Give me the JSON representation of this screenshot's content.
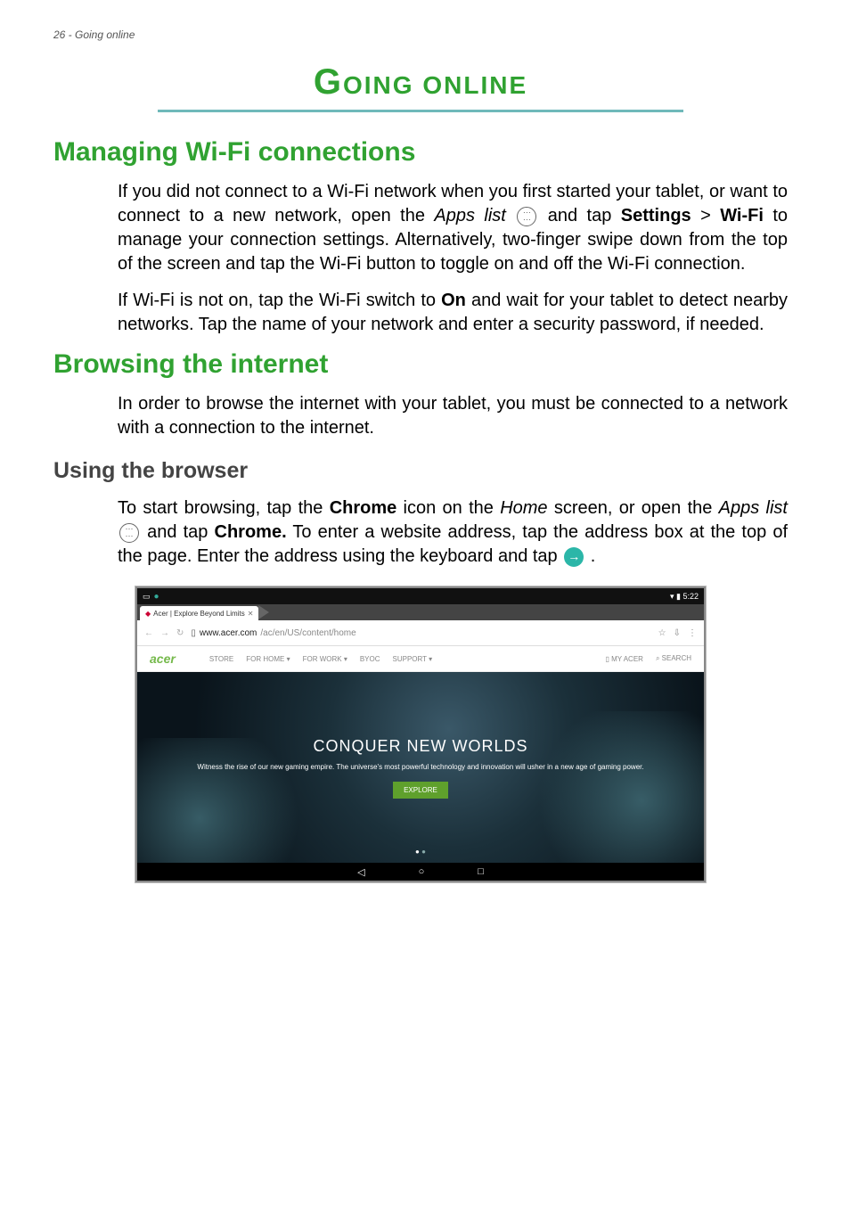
{
  "page_header": "26 - Going online",
  "main_title_first": "G",
  "main_title_rest": "OING ONLINE",
  "section_wifi_title": "Managing Wi-Fi connections",
  "wifi_p1_a": "If you did not connect to a Wi-Fi network when you first started your tablet, or want to connect to a new network, open the ",
  "wifi_p1_appslist": "Apps list",
  "wifi_p1_b": " and tap ",
  "wifi_p1_settings": "Settings",
  "wifi_p1_gt": " > ",
  "wifi_p1_wifi": "Wi-Fi",
  "wifi_p1_c": " to manage your connection settings. Alternatively, two-finger swipe down from the top of the screen and tap the Wi-Fi button to toggle on and off the Wi-Fi connection.",
  "wifi_p2_a": "If Wi-Fi is not on, tap the Wi-Fi switch to ",
  "wifi_p2_on": "On",
  "wifi_p2_b": " and wait for your tablet to detect nearby networks. Tap the name of your network and enter a security password, if needed.",
  "section_browse_title": "Browsing the internet",
  "browse_p1": "In order to browse the internet with your tablet, you must be connected to a network with a connection to the internet.",
  "subsection_browser_title": "Using the browser",
  "browser_p1_a": "To start browsing, tap the ",
  "browser_p1_chrome1": "Chrome",
  "browser_p1_b": " icon on the ",
  "browser_p1_home": "Home",
  "browser_p1_c": " screen, or open the ",
  "browser_p1_appslist": "Apps list",
  "browser_p1_d": " and tap ",
  "browser_p1_chrome2": "Chrome.",
  "browser_p1_e": " To enter a website address, tap the address box at the top of the page. Enter the address using the keyboard and tap ",
  "browser_p1_f": " .",
  "shot": {
    "status_time": "5:22",
    "tab_title": "Acer | Explore Beyond Limits",
    "url_main": "www.acer.com",
    "url_rest": "/ac/en/US/content/home",
    "logo": "acer",
    "nav": {
      "store": "STORE",
      "for_home": "FOR HOME",
      "for_work": "FOR WORK",
      "byoc": "BYOC",
      "support": "SUPPORT",
      "my_acer": "MY ACER",
      "search": "SEARCH"
    },
    "hero_title": "CONQUER NEW WORLDS",
    "hero_sub": "Witness the rise of our new gaming empire. The universe's most powerful technology and innovation will usher in a new age of gaming power.",
    "hero_cta": "EXPLORE"
  }
}
